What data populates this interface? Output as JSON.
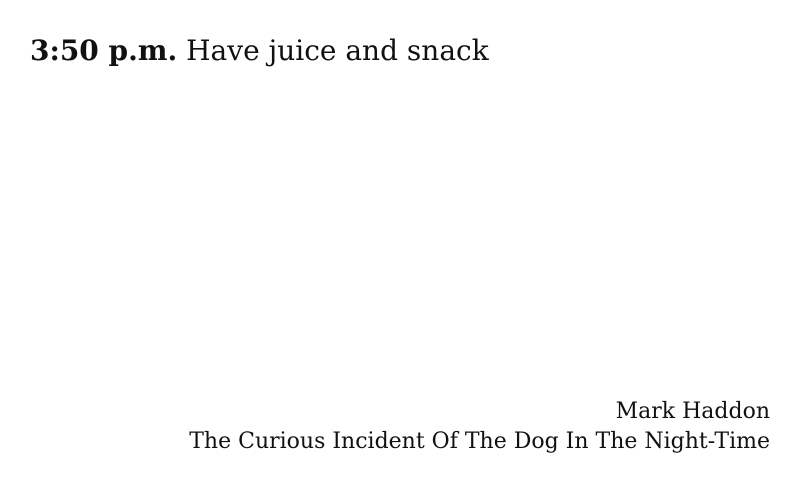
{
  "clock": {
    "time": "3:50 p.m.",
    "text": "Have juice and snack"
  },
  "attribution": {
    "author": "Mark Haddon",
    "title": "The Curious Incident Of The Dog In The Night-Time"
  }
}
